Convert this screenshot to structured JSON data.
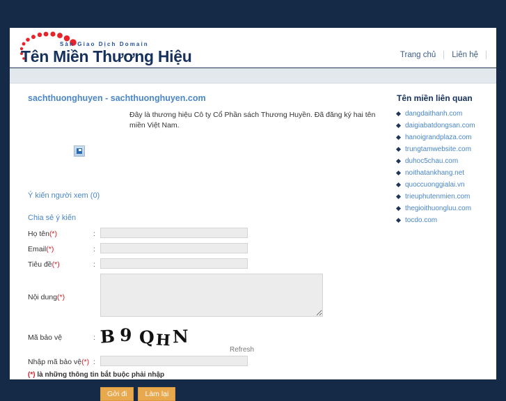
{
  "header": {
    "logo_tagline": "Sàn Giao Dịch Domain",
    "logo_title": "Tên Miền Thương Hiệu",
    "nav": [
      {
        "label": "Trang chủ"
      },
      {
        "label": "Liên hệ"
      }
    ]
  },
  "main": {
    "domain_title": "sachthuonghuyen - sachthuonghuyen.com",
    "domain_description": "Đây là thương hiệu Cô ty Cổ Phần sách Thương Huyền. Đã đăng ký hai tên miền Việt Nam.",
    "broken_image_icon": "broken-image-icon",
    "comments_heading": "Ý kiến người xem (0)",
    "share_heading": "Chia sẻ ý kiến",
    "form": {
      "colon": ":",
      "fields": [
        {
          "label": "Họ tên",
          "required": "(*)",
          "value": "",
          "placeholder": ""
        },
        {
          "label": "Email",
          "required": "(*)",
          "value": "",
          "placeholder": ""
        },
        {
          "label": "Tiêu đề",
          "required": "(*)",
          "value": "",
          "placeholder": ""
        }
      ],
      "content_field": {
        "label": "Nội dung",
        "required": "(*)",
        "value": "",
        "placeholder": ""
      },
      "captcha_label": "Mã bảo vệ",
      "captcha_chars": [
        "B",
        "9",
        "Q",
        "H",
        "N"
      ],
      "refresh_label": "Refresh",
      "captcha_input": {
        "label": "Nhập mã bảo vệ",
        "required": "(*)",
        "value": "",
        "placeholder": ""
      },
      "note_mark": "(*)",
      "note_text": " là những thông tin bắt buộc phải nhập",
      "submit_label": "Gởi đi",
      "reset_label": "Làm lại"
    }
  },
  "sidebar": {
    "title": "Tên miền liên quan",
    "items": [
      {
        "label": "dangdaithanh.com"
      },
      {
        "label": "daigiabatdongsan.com"
      },
      {
        "label": "hanoigrandplaza.com"
      },
      {
        "label": "trungtamwebsite.com"
      },
      {
        "label": "duhoc5chau.com"
      },
      {
        "label": "noithatankhang.net"
      },
      {
        "label": "quoccuonggialai.vn"
      },
      {
        "label": "trieuphutenmien.com"
      },
      {
        "label": "thegioithuongluu.com"
      },
      {
        "label": "tocdo.com"
      }
    ]
  },
  "colors": {
    "page_background": "#152a47",
    "brand_navy": "#16315c",
    "link_blue": "#4a86c8",
    "accent_red": "#d81f26",
    "button_orange": "#e8a84e",
    "band_gray": "#e3e8ec"
  }
}
